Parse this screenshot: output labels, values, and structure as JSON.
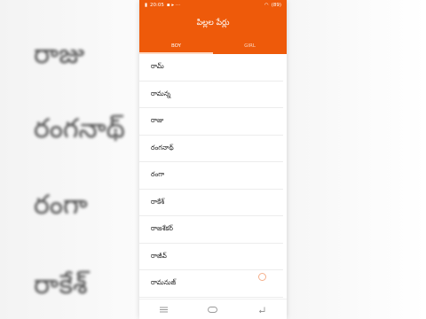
{
  "background_words": [
    "రాజు",
    "రంగనాథ్",
    "రంగా",
    "రాకేశ్"
  ],
  "status_bar": {
    "time": "20:05",
    "battery": "(89)"
  },
  "app_bar": {
    "title": "పిల్లల పేర్లు"
  },
  "tabs": [
    {
      "label": "BOY",
      "active": true
    },
    {
      "label": "GIRL",
      "active": false
    }
  ],
  "names": [
    "రామ్",
    "రామన్న",
    "రాజు",
    "రంగనాథ్",
    "రంగా",
    "రాకేశ్",
    "రాజశేకర్",
    "రాజీవ్",
    "రామనుజ్"
  ],
  "colors": {
    "accent": "#ee5a0a"
  }
}
